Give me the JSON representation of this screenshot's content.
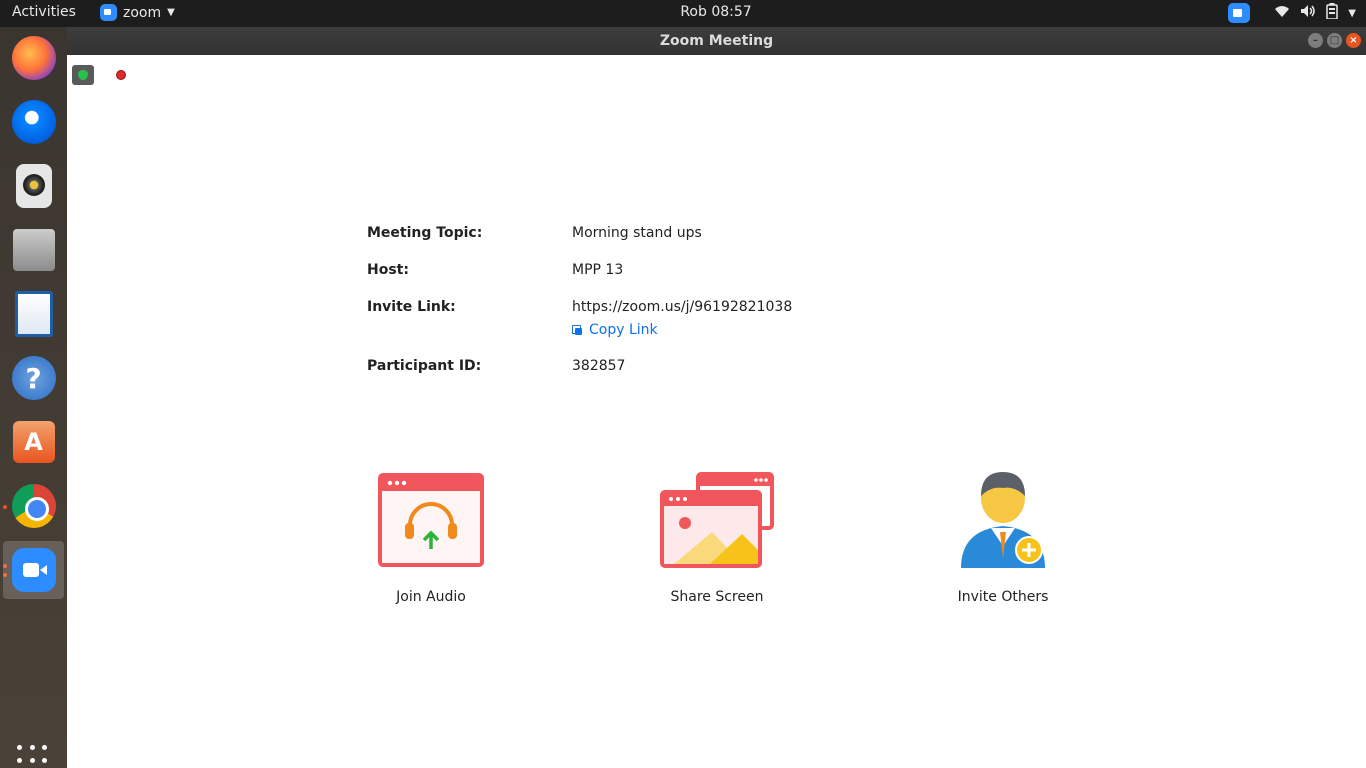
{
  "topbar": {
    "activities": "Activities",
    "app_name": "zoom",
    "clock": "Rob 08:57"
  },
  "window": {
    "title": "Zoom Meeting"
  },
  "meeting": {
    "topic_label": "Meeting Topic:",
    "topic": "Morning stand ups",
    "host_label": "Host:",
    "host": "MPP 13",
    "invite_label": "Invite Link:",
    "invite_link": "https://zoom.us/j/96192821038",
    "copy_link": "Copy Link",
    "participant_label": "Participant ID:",
    "participant_id": "382857"
  },
  "actions": {
    "join_audio": "Join Audio",
    "share_screen": "Share Screen",
    "invite_others": "Invite Others"
  },
  "colors": {
    "zoom_blue": "#2d8cff",
    "link_blue": "#0e72ed",
    "icon_red": "#f0565b",
    "ubuntu_orange": "#e95420"
  },
  "dock": {
    "items": [
      "firefox-icon",
      "thunderbird-icon",
      "rhythmbox-icon",
      "files-icon",
      "writer-icon",
      "help-icon",
      "software-icon",
      "chrome-icon",
      "zoom-icon"
    ]
  }
}
